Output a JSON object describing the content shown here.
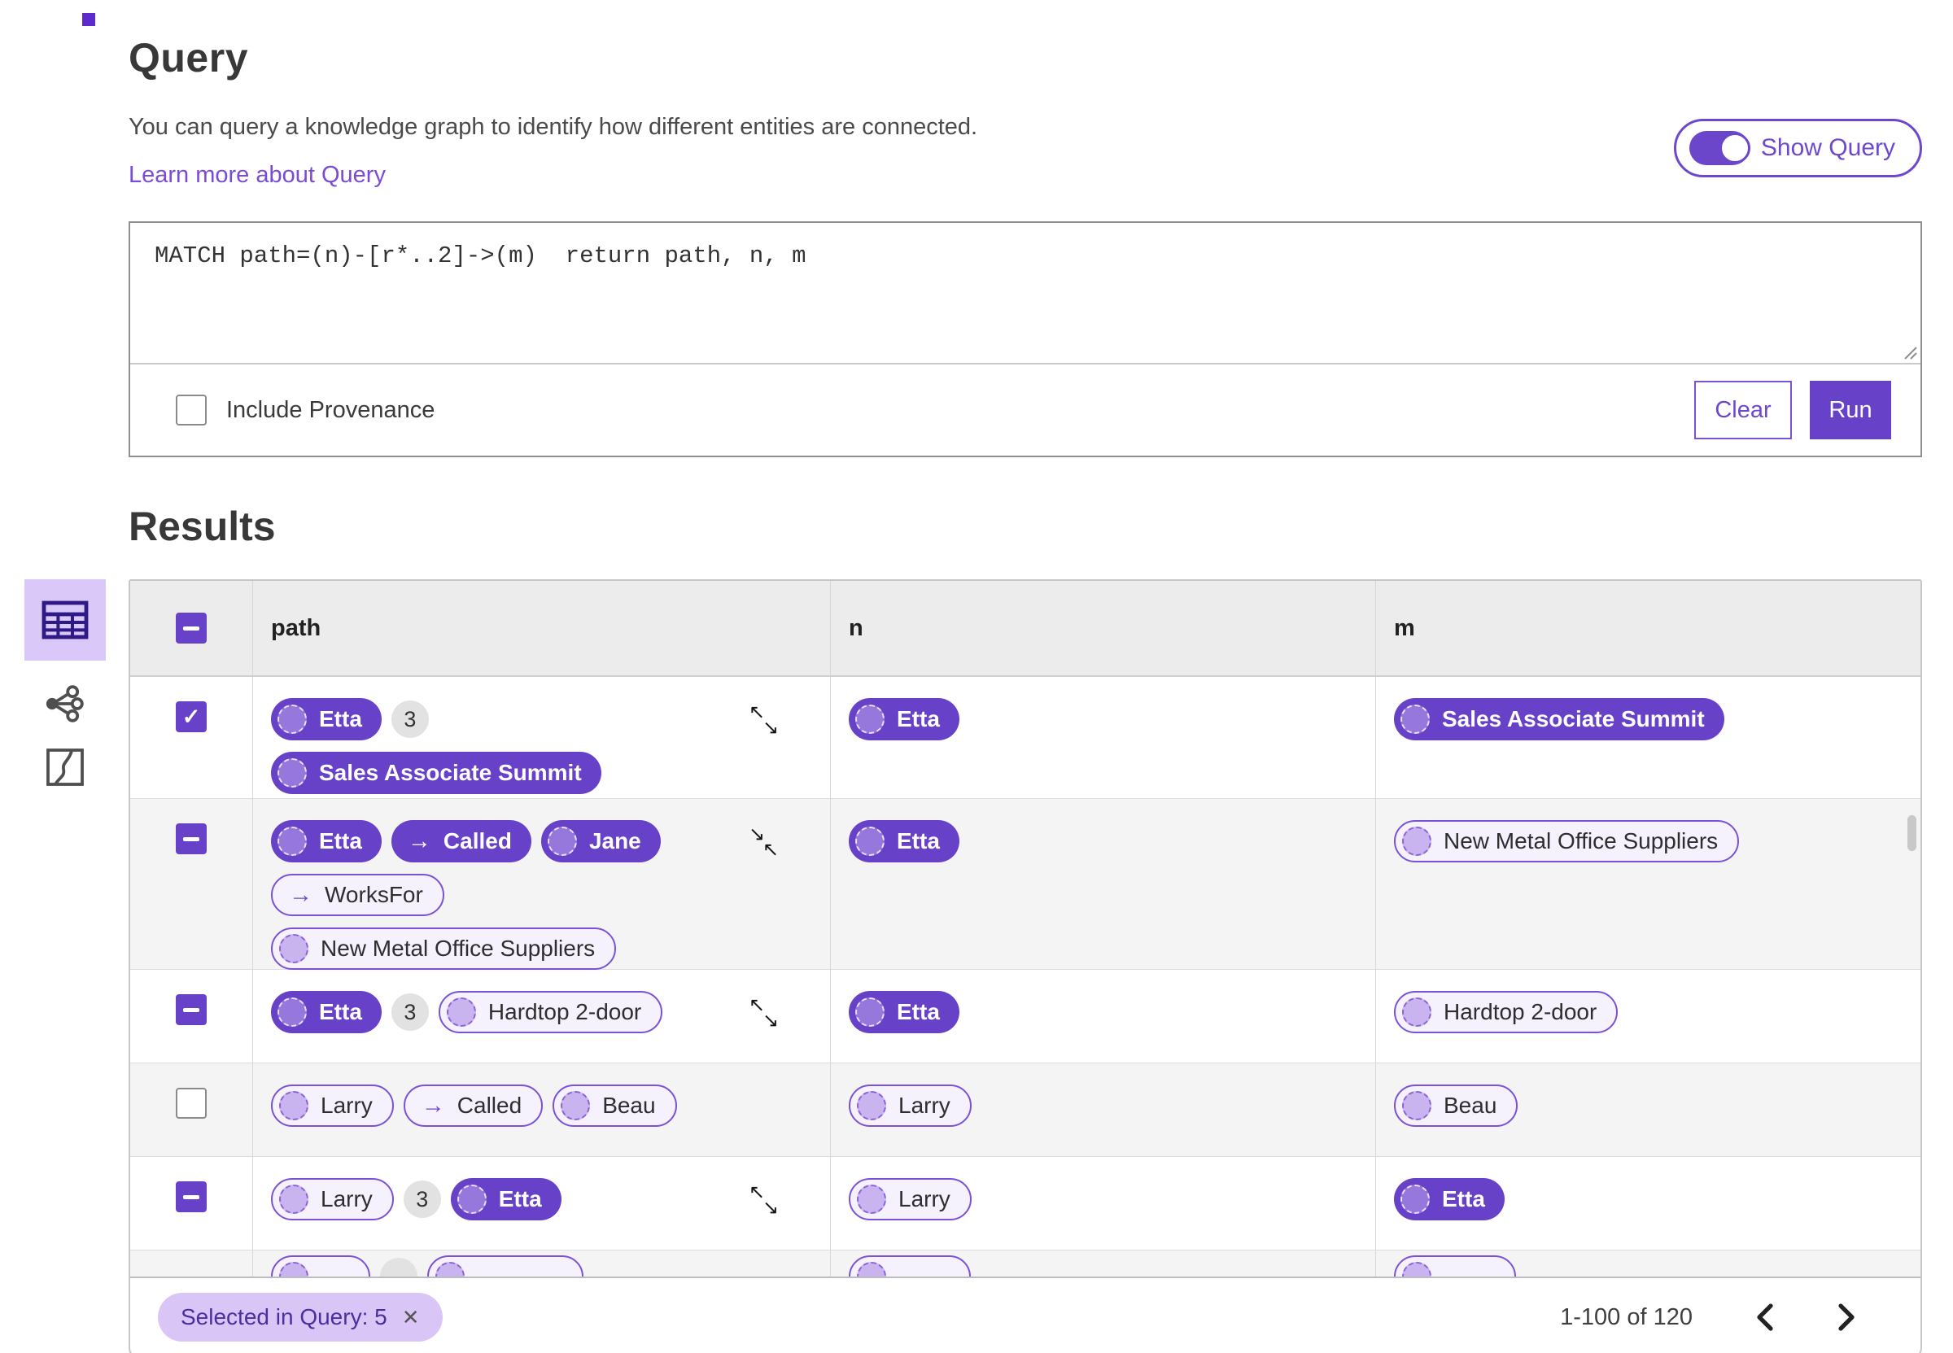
{
  "header": {
    "title": "Query",
    "description": "You can query a knowledge graph to identify how different entities are connected.",
    "learn_more_link": "Learn more about Query",
    "show_query": {
      "label": "Show Query",
      "state": "on"
    }
  },
  "query_editor": {
    "query_text": "MATCH path=(n)-[r*..2]->(m)  return path, n, m",
    "include_provenance": {
      "label": "Include Provenance",
      "checked": false
    },
    "buttons": {
      "clear": "Clear",
      "run": "Run"
    }
  },
  "results": {
    "title": "Results",
    "view_switcher": [
      "table-view",
      "graph-view",
      "map-view"
    ],
    "active_view": "table-view",
    "table": {
      "columns": [
        "path",
        "n",
        "m"
      ],
      "rows": [
        {
          "checkbox": "checked",
          "path": {
            "lines": [
              [
                {
                  "kind": "node",
                  "style": "filled",
                  "label": "Etta"
                },
                {
                  "kind": "badge",
                  "label": "3"
                }
              ],
              [
                {
                  "kind": "node",
                  "style": "filled",
                  "label": "Sales Associate Summit"
                }
              ]
            ],
            "corner_icon": "expand"
          },
          "n": [
            {
              "kind": "node",
              "style": "filled",
              "label": "Etta"
            }
          ],
          "m": [
            {
              "kind": "node",
              "style": "filled",
              "label": "Sales Associate Summit"
            }
          ]
        },
        {
          "checkbox": "indeterminate",
          "path": {
            "lines": [
              [
                {
                  "kind": "node",
                  "style": "filled",
                  "label": "Etta"
                },
                {
                  "kind": "rel",
                  "style": "filled",
                  "label": "Called"
                },
                {
                  "kind": "node",
                  "style": "filled",
                  "label": "Jane"
                }
              ],
              [
                {
                  "kind": "rel",
                  "style": "outlined",
                  "label": "WorksFor"
                }
              ],
              [
                {
                  "kind": "node",
                  "style": "outlined",
                  "label": "New Metal Office Suppliers"
                }
              ]
            ],
            "corner_icon": "collapse"
          },
          "n": [
            {
              "kind": "node",
              "style": "filled",
              "label": "Etta"
            }
          ],
          "m": [
            {
              "kind": "node",
              "style": "outlined",
              "label": "New Metal Office Suppliers"
            }
          ]
        },
        {
          "checkbox": "indeterminate",
          "path": {
            "lines": [
              [
                {
                  "kind": "node",
                  "style": "filled",
                  "label": "Etta"
                },
                {
                  "kind": "badge",
                  "label": "3"
                },
                {
                  "kind": "node",
                  "style": "outlined",
                  "label": "Hardtop 2-door"
                }
              ]
            ],
            "corner_icon": "expand"
          },
          "n": [
            {
              "kind": "node",
              "style": "filled",
              "label": "Etta"
            }
          ],
          "m": [
            {
              "kind": "node",
              "style": "outlined",
              "label": "Hardtop 2-door"
            }
          ]
        },
        {
          "checkbox": "unchecked",
          "path": {
            "lines": [
              [
                {
                  "kind": "node",
                  "style": "outlined",
                  "label": "Larry"
                },
                {
                  "kind": "rel",
                  "style": "outlined",
                  "label": "Called"
                },
                {
                  "kind": "node",
                  "style": "outlined",
                  "label": "Beau"
                }
              ]
            ],
            "corner_icon": null
          },
          "n": [
            {
              "kind": "node",
              "style": "outlined",
              "label": "Larry"
            }
          ],
          "m": [
            {
              "kind": "node",
              "style": "outlined",
              "label": "Beau"
            }
          ]
        },
        {
          "checkbox": "indeterminate",
          "path": {
            "lines": [
              [
                {
                  "kind": "node",
                  "style": "outlined",
                  "label": "Larry"
                },
                {
                  "kind": "badge",
                  "label": "3"
                },
                {
                  "kind": "node",
                  "style": "filled",
                  "label": "Etta"
                }
              ]
            ],
            "corner_icon": "expand"
          },
          "n": [
            {
              "kind": "node",
              "style": "outlined",
              "label": "Larry"
            }
          ],
          "m": [
            {
              "kind": "node",
              "style": "filled",
              "label": "Etta"
            }
          ]
        },
        {
          "partial": true,
          "checkbox": null,
          "path": {
            "lines": [
              [
                {
                  "kind": "node",
                  "style": "outlined",
                  "label": ""
                },
                {
                  "kind": "badge",
                  "label": ""
                },
                {
                  "kind": "node",
                  "style": "outlined",
                  "label": ""
                }
              ]
            ],
            "corner_icon": null
          },
          "n": [
            {
              "kind": "node",
              "style": "outlined",
              "label": ""
            }
          ],
          "m": [
            {
              "kind": "node",
              "style": "outlined",
              "label": ""
            }
          ]
        }
      ]
    },
    "footer": {
      "selected_chip": "Selected in Query: 5",
      "range_label": "1-100 of 120"
    }
  },
  "icons": {
    "arrow_right": "→",
    "expand_nw": "↖",
    "expand_se": "↘",
    "close": "✕",
    "check": "✓"
  },
  "colors": {
    "purple": "#6741c8",
    "purple_border": "#7a52d8",
    "lavender": "#d9c7f8",
    "link": "#7a4bd6",
    "pill_outline_bg": "#f5f1fd",
    "row_stripe": "#f4f4f4",
    "header_bg": "#ececec"
  }
}
